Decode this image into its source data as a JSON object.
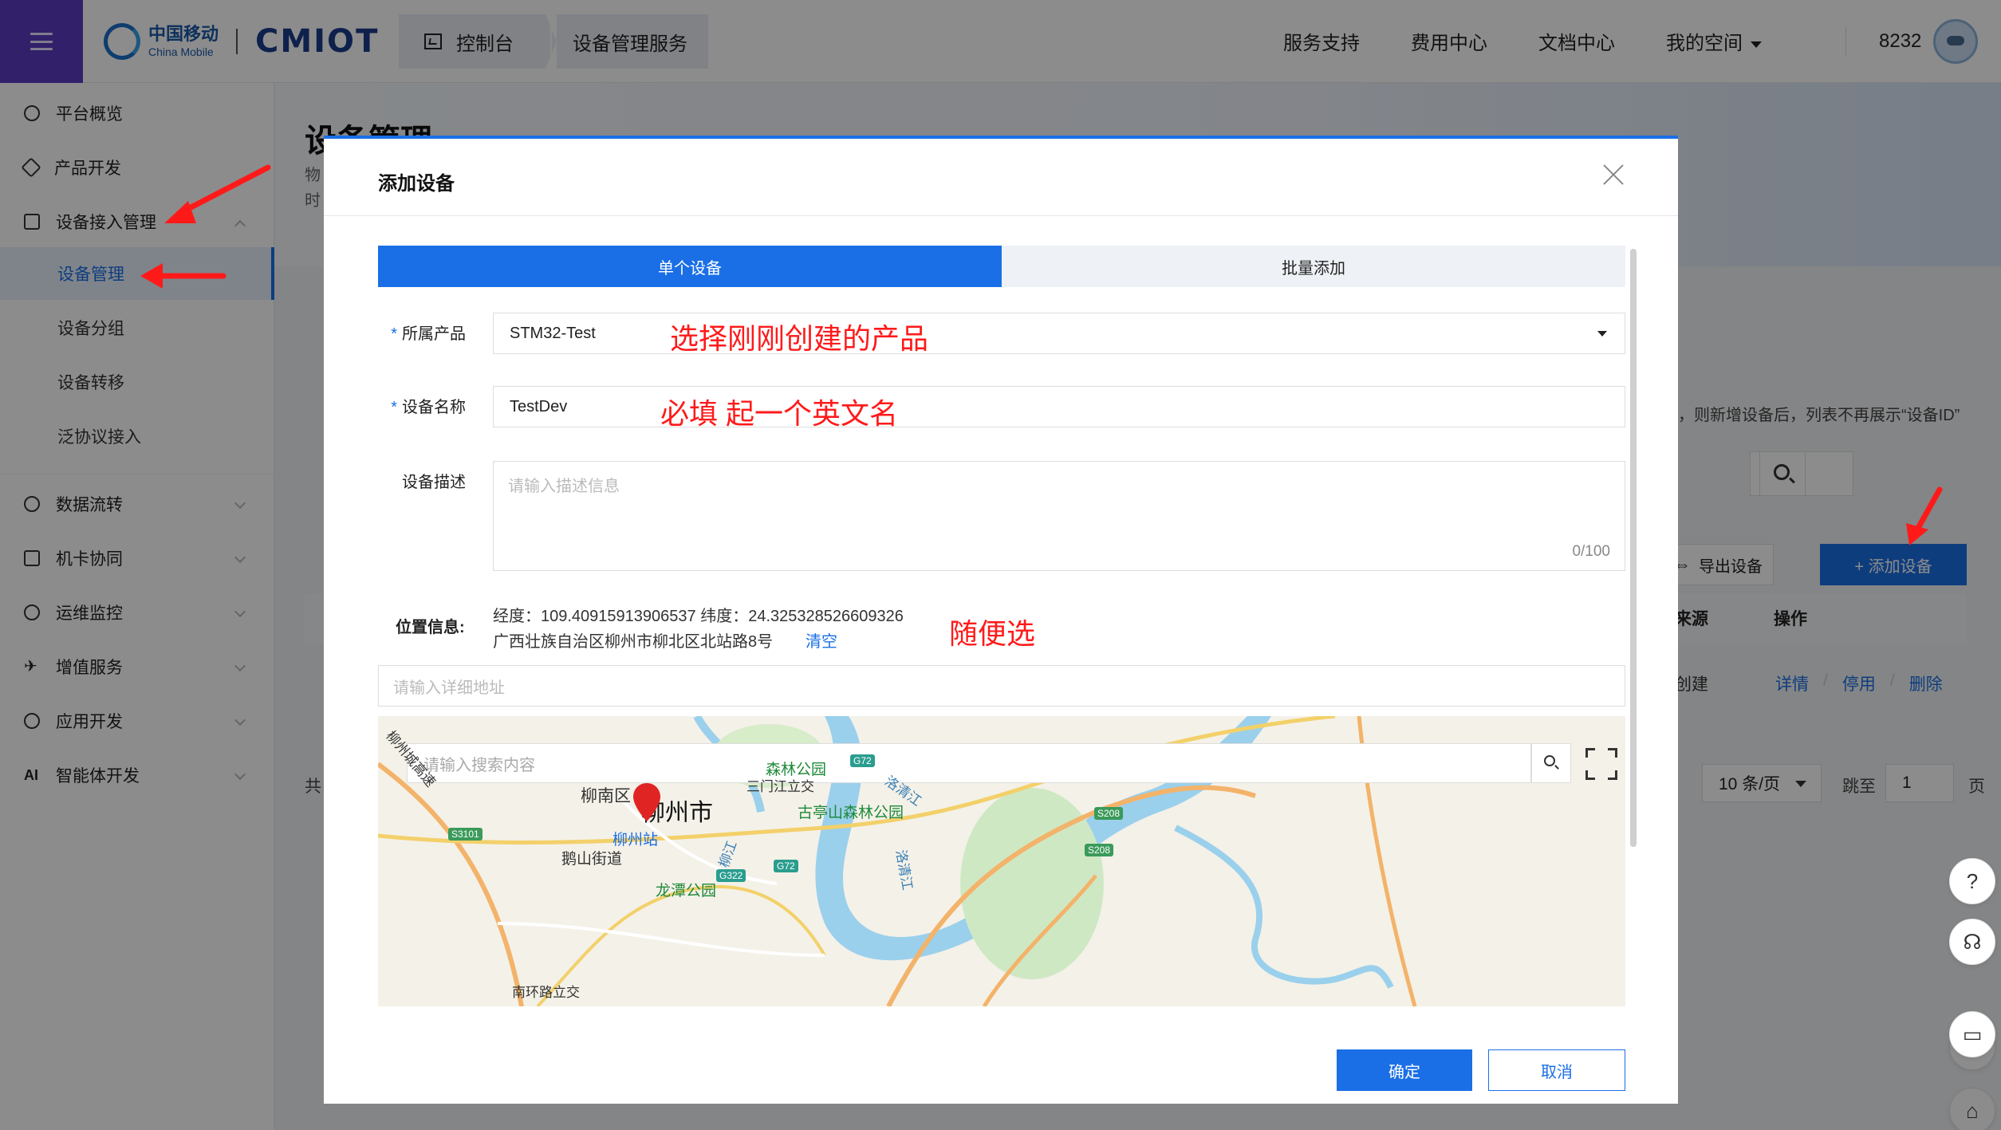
{
  "topbar": {
    "brand_cn": "中国移动",
    "brand_en": "China Mobile",
    "brand_product": "CMIOT",
    "breadcrumbs": [
      "控制台",
      "设备管理服务"
    ],
    "nav": [
      "服务支持",
      "费用中心",
      "文档中心",
      "我的空间"
    ],
    "user_id": "8232"
  },
  "sidebar": {
    "items": [
      {
        "label": "平台概览",
        "icon": "dashboard-icon"
      },
      {
        "label": "产品开发",
        "icon": "cube-icon"
      },
      {
        "label": "设备接入管理",
        "icon": "device-icon"
      },
      {
        "label": "数据流转",
        "icon": "flow-icon"
      },
      {
        "label": "机卡协同",
        "icon": "sim-icon"
      },
      {
        "label": "运维监控",
        "icon": "monitor-icon"
      },
      {
        "label": "增值服务",
        "icon": "plane-icon"
      },
      {
        "label": "应用开发",
        "icon": "app-icon"
      },
      {
        "label": "智能体开发",
        "icon": "ai-icon"
      }
    ],
    "sub_items": [
      "设备管理",
      "设备分组",
      "设备转移",
      "泛协议接入"
    ],
    "active_sub": "设备管理"
  },
  "main": {
    "page_title": "设备管理",
    "desc_line1": "物",
    "desc_line2": "时",
    "note": "，则新增设备后，列表不再展示“设备ID”",
    "export_label": "导出设备",
    "add_label": "+  添加设备",
    "table": {
      "headers": [
        "来源",
        "操作"
      ],
      "row_source": "创建",
      "row_actions": [
        "详情",
        "停用",
        "删除"
      ]
    },
    "pagination": {
      "total_prefix": "共",
      "page_size": "10 条/页",
      "jump_label": "跳至",
      "jump_value": "1",
      "page_suffix": "页"
    }
  },
  "modal": {
    "title": "添加设备",
    "tabs": [
      "单个设备",
      "批量添加"
    ],
    "active_tab": "单个设备",
    "fields": {
      "product_label": "所属产品",
      "product_value": "STM32-Test",
      "name_label": "设备名称",
      "name_value": "TestDev",
      "desc_label": "设备描述",
      "desc_placeholder": "请输入描述信息",
      "desc_count": "0/100"
    },
    "location": {
      "label": "位置信息:",
      "coords": "经度：109.40915913906537   纬度：24.325328526609326",
      "address": "广西壮族自治区柳州市柳北区北站路8号",
      "clear_label": "清空",
      "detail_placeholder": "请输入详细地址",
      "map_search_placeholder": "请输入搜索内容"
    },
    "map_labels": {
      "city": "柳州市",
      "district": "柳南区",
      "station": "柳州站",
      "street": "鹅山街道",
      "park1": "森林公园",
      "park2": "古亭山森林公园",
      "park3": "龙潭公园",
      "interchange": "三门江立交",
      "river1": "洛清江",
      "river2": "柳江",
      "river3": "洛清江",
      "road_s3101": "S3101",
      "road_g72": "G72",
      "road_g322": "G322",
      "road_s208": "S208",
      "road_s208b": "S208",
      "road_g72b": "G72",
      "expressway": "柳州城高速",
      "ring": "南环路立交"
    },
    "ok_label": "确定",
    "cancel_label": "取消"
  },
  "annotations": {
    "note_product": "选择刚刚创建的产品",
    "note_name": "必填 起一个英文名",
    "note_location": "随便选",
    "color": "#ff1a1a"
  },
  "colors": {
    "primary": "#1a6fe6",
    "menu_bg": "#5b3bc4"
  }
}
